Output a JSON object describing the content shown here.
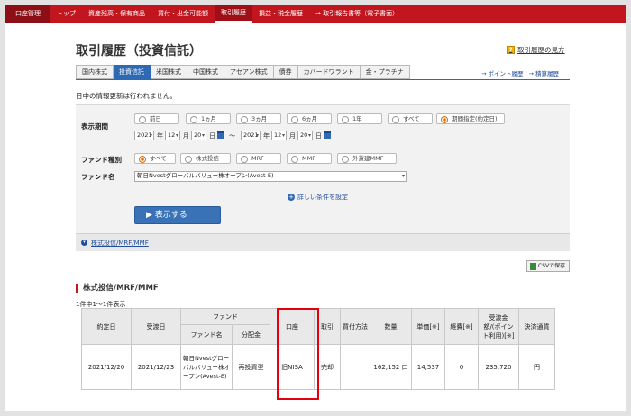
{
  "nav": {
    "items": [
      "口座管理",
      "トップ",
      "資産残高・保有商品",
      "買付・出金可能額",
      "取引履歴",
      "損益・税金履歴",
      "→ 取引報告書等（電子書面）"
    ]
  },
  "page": {
    "title": "取引履歴（投資信託）",
    "help_link": "取引履歴の見方",
    "notice": "日中の情報更新は行われません。"
  },
  "tabs": [
    "国内株式",
    "投資信託",
    "米国株式",
    "中国株式",
    "アセアン株式",
    "債券",
    "カバードワラント",
    "金・プラチナ"
  ],
  "right_links": [
    "→ ポイント履歴",
    "→ 積算履歴"
  ],
  "search": {
    "period_label": "表示期間",
    "period_options": [
      "前日",
      "1ヵ月",
      "3ヵ月",
      "6ヵ月",
      "1年",
      "すべて",
      "期間指定(約定日)"
    ],
    "period_selected": "期間指定(約定日)",
    "from": {
      "year": "2021",
      "month": "12",
      "day": "20"
    },
    "to": {
      "year": "2021",
      "month": "12",
      "day": "20"
    },
    "unit_year": "年",
    "unit_month": "月",
    "unit_day": "日",
    "range_sep": "〜",
    "fund_type_label": "ファンド種別",
    "fund_type_options": [
      "すべて",
      "株式投信",
      "MRF",
      "MMF",
      "外貨建MMF"
    ],
    "fund_type_selected": "すべて",
    "fund_name_label": "ファンド名",
    "fund_name_value": "朝日Nvestグローバルバリュー株オープン(Avest-E)",
    "detail_link": "詳しい条件を設定",
    "display_button": "▶ 表示する"
  },
  "section_toggle": "株式投信/MRF/MMF",
  "csv_button": "CSVで保存",
  "results": {
    "title": "株式投信/MRF/MMF",
    "count": "1件中1〜1件表示",
    "headers": {
      "trade_date": "約定日",
      "settle_date": "受渡日",
      "fund": "ファンド",
      "fund_name": "ファンド名",
      "distribution": "分配金",
      "account": "口座",
      "trade": "取引",
      "buy_method": "買付方法",
      "quantity": "数量",
      "unit_price": "単価[※]",
      "fee": "経費[※]",
      "settle_amount": "受渡金額/(ポイント利用)[※]",
      "currency": "決済通貨"
    },
    "rows": [
      {
        "trade_date": "2021/12/20",
        "settle_date": "2021/12/23",
        "fund_name": "朝日Nvestグローバルバリュー株オープン(Avest-E)",
        "distribution": "再投資型",
        "account": "旧NISA",
        "trade": "売却",
        "buy_method": "",
        "quantity": "162,152 口",
        "unit_price": "14,537",
        "fee": "0",
        "settle_amount": "235,720",
        "currency": "円"
      }
    ]
  }
}
